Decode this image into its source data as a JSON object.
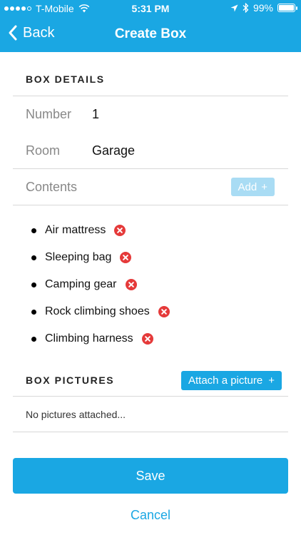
{
  "status_bar": {
    "carrier": "T-Mobile",
    "time": "5:31 PM",
    "battery": "99%",
    "battery_level": 0.99
  },
  "navbar": {
    "back_label": "Back",
    "title": "Create Box"
  },
  "box_details": {
    "section_title": "BOX DETAILS",
    "number_label": "Number",
    "number_value": "1",
    "room_label": "Room",
    "room_value": "Garage",
    "contents_label": "Contents",
    "add_label": "Add",
    "add_icon": "+"
  },
  "contents": [
    "Air mattress",
    "Sleeping bag",
    "Camping gear",
    "Rock climbing shoes",
    "Climbing harness"
  ],
  "box_pictures": {
    "section_title": "BOX PICTURES",
    "attach_label": "Attach a picture",
    "attach_icon": "+",
    "empty_text": "No pictures attached..."
  },
  "actions": {
    "save_label": "Save",
    "cancel_label": "Cancel"
  },
  "colors": {
    "accent": "#1aa7e3",
    "disabled_accent": "#a9dcf4",
    "remove": "#e53a3a"
  }
}
